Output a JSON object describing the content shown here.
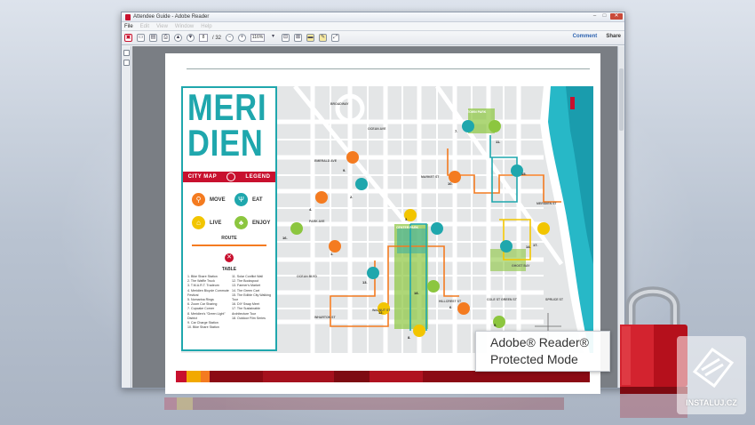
{
  "window": {
    "title": "Attendee Guide - Adobe Reader",
    "menu": [
      "File",
      "Edit",
      "View",
      "Window",
      "Help"
    ],
    "controls": {
      "minimize": "–",
      "maximize": "□",
      "close": "✕"
    }
  },
  "toolbar": {
    "page_current": "8",
    "page_total": "/ 32",
    "zoom": "116%",
    "comment_label": "Comment",
    "share_label": "Share"
  },
  "map": {
    "title_line1": "MERI",
    "title_line2": "DIEN",
    "banner_left": "CITY MAP",
    "banner_right": "LEGEND",
    "legend": {
      "move": "MOVE",
      "eat": "EAT",
      "live": "LIVE",
      "enjoy": "ENJOY"
    },
    "route_label": "ROUTE",
    "table_label": "TABLE",
    "table_col1": [
      "1. Bike Share Station",
      "2. The Waffle Truck",
      "3. T.M.A.R.T. Tradeum",
      "4. Meridien Bicycle Commute Festival",
      "5. Nomarina Rings",
      "6. Zoom Car Sharing",
      "7. Cupcake Corner",
      "8. Meridien's \"Green Light\" District",
      "9. Car Charge Station",
      "10. Bike Share Station"
    ],
    "table_col2": [
      "11. Solar Conflict Wall",
      "12. The Bookspout",
      "13. Farmer's Market",
      "14. The Green Cart",
      "15. The Edible City Walking Tour",
      "16. DIY Swap Meet",
      "17. The Sustainable Architecture Tour",
      "18. Outdoor Film Series"
    ],
    "street_labels": [
      "BROADWAY",
      "OCEAN AVE",
      "EMERALD AVE",
      "PARK AVE",
      "MARKET ST",
      "MERIDIEN ST",
      "WHARTON ST",
      "OCEAN BLVD",
      "WALNUT ST",
      "HILLCREST ST",
      "COLE ST",
      "GREEN ST",
      "SPRUCE ST",
      "TOWN PARK",
      "CENTER PARK",
      "GHOST BAY"
    ],
    "markers": [
      "1.",
      "2.",
      "3.",
      "4.",
      "5.",
      "6.",
      "7.",
      "8.",
      "9.",
      "10.",
      "11.",
      "12.",
      "13.",
      "14.",
      "15.",
      "16.",
      "17.",
      "18."
    ]
  },
  "badge": {
    "line1": "Adobe® Reader®",
    "line2": "Protected Mode"
  },
  "watermark": "INSTALUJ.CZ",
  "colors": {
    "teal": "#1fa7ad",
    "orange": "#f47b20",
    "green": "#8cc63f",
    "red": "#c8102e",
    "yellow": "#f2c500"
  }
}
